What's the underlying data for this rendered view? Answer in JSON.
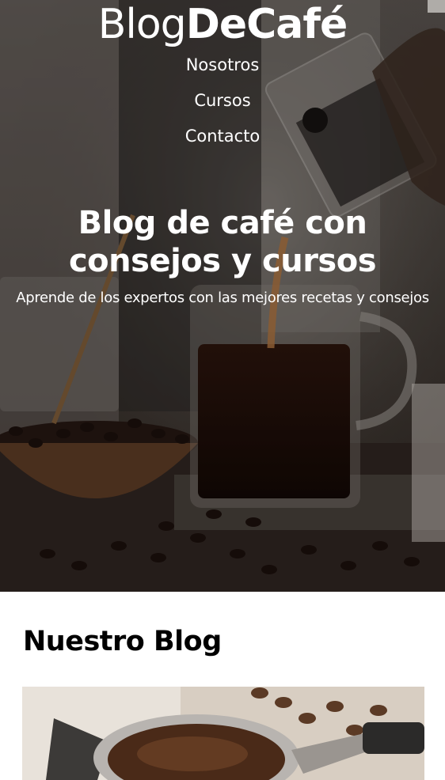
{
  "header": {
    "logo_light": "Blog",
    "logo_bold": "DeCafé"
  },
  "nav": {
    "items": [
      "Nosotros",
      "Cursos",
      "Contacto"
    ]
  },
  "hero": {
    "title": "Blog de café con consejos y cursos",
    "subtitle": "Aprende de los expertos con las mejores recetas y consejos"
  },
  "blog": {
    "title": "Nuestro Blog"
  }
}
